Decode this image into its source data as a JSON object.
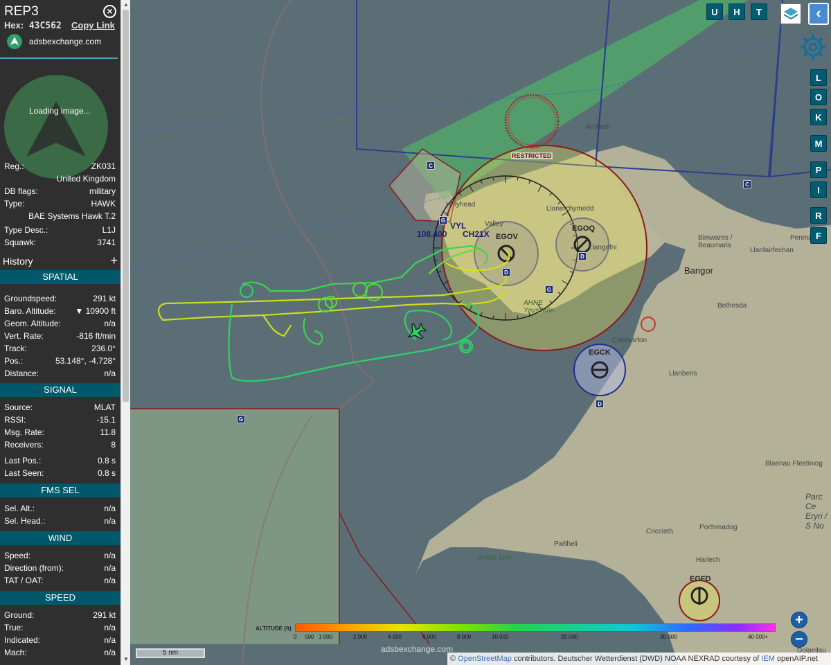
{
  "aircraft": {
    "callsign": "REP3",
    "hex_label": "Hex:",
    "hex": "43C562",
    "copy_link": "Copy Link",
    "brand": "adsbexchange.com",
    "photo_status": "Loading image..."
  },
  "details": [
    {
      "label": "Reg.:",
      "value": "ZK031"
    },
    {
      "label": "",
      "value": "United Kingdom"
    },
    {
      "label": "DB flags:",
      "value": "military"
    },
    {
      "label": "Type:",
      "value": "HAWK"
    },
    {
      "label": "",
      "value": "BAE Systems Hawk T.2"
    },
    {
      "label": "Type Desc.:",
      "value": "L1J"
    },
    {
      "label": "Squawk:",
      "value": "3741"
    }
  ],
  "history": {
    "label": "History",
    "toggle": "+"
  },
  "sections": {
    "spatial": {
      "title": "SPATIAL",
      "rows": [
        {
          "label": "Groundspeed:",
          "value": "291 kt"
        },
        {
          "label": "Baro. Altitude:",
          "value": "▼ 10900 ft"
        },
        {
          "label": "Geom. Altitude:",
          "value": "n/a"
        },
        {
          "label": "Vert. Rate:",
          "value": "-816 ft/min"
        },
        {
          "label": "Track:",
          "value": "236.0°"
        },
        {
          "label": "Pos.:",
          "value": "53.148°, -4.728°"
        },
        {
          "label": "Distance:",
          "value": "n/a"
        }
      ]
    },
    "signal": {
      "title": "SIGNAL",
      "rows": [
        {
          "label": "Source:",
          "value": "MLAT"
        },
        {
          "label": "RSSI:",
          "value": "-15.1"
        },
        {
          "label": "Msg. Rate:",
          "value": "11.8"
        },
        {
          "label": "Receivers:",
          "value": "8"
        },
        {
          "label": "Last Pos.:",
          "value": "0.8 s"
        },
        {
          "label": "Last Seen:",
          "value": "0.8 s"
        }
      ]
    },
    "fms": {
      "title": "FMS SEL",
      "rows": [
        {
          "label": "Sel. Alt.:",
          "value": "n/a"
        },
        {
          "label": "Sel. Head.:",
          "value": "n/a"
        }
      ]
    },
    "wind": {
      "title": "WIND",
      "rows": [
        {
          "label": "Speed:",
          "value": "n/a"
        },
        {
          "label": "Direction (from):",
          "value": "n/a"
        },
        {
          "label": "TAT / OAT:",
          "value": "n/a"
        }
      ]
    },
    "speed": {
      "title": "SPEED",
      "rows": [
        {
          "label": "Ground:",
          "value": "291 kt"
        },
        {
          "label": "True:",
          "value": "n/a"
        },
        {
          "label": "Indicated:",
          "value": "n/a"
        },
        {
          "label": "Mach:",
          "value": "n/a"
        }
      ]
    }
  },
  "toolbar": {
    "top_buttons": [
      "U",
      "H",
      "T"
    ],
    "side_buttons": [
      "L",
      "O",
      "K",
      "M",
      "P",
      "I",
      "R",
      "F"
    ],
    "zoom_in": "+",
    "zoom_out": "−",
    "back": "‹"
  },
  "map": {
    "places": {
      "amlwch": "Amlwch",
      "llanerchymedd": "Llanerchymedd",
      "holyhead": "Holyhead",
      "valley": "Valley",
      "llangefni": "Llangefni",
      "bangor": "Bangor",
      "beaumaris": "Bimwares / Beaumaris",
      "penmaenmawr": "Penmaenm",
      "llanfairfechan": "Llanfairfechan",
      "bethesda": "Bethesda",
      "caernarfon": "Caernarfon",
      "llanberis": "Llanberis",
      "ahne_ynys": "AHNE Ynys Môn",
      "blaenau": "Blaenau Ffestiniog",
      "parc": "Parc Ce Eryri / S No",
      "criccieth": "Criccieth",
      "porthmadog": "Porthmadog",
      "pwllheli": "Pwllheli",
      "harlech": "Harlech",
      "ahne_llyn": "AHNE Llŷn",
      "dolgellau": "Dolgellau"
    },
    "airports": {
      "egov": "EGOV",
      "egoq": "EGOQ",
      "egck": "EGCK",
      "egfd": "EGFD"
    },
    "vor": {
      "name": "VYL",
      "freq": "108.400",
      "channel": "CH21X"
    },
    "restricted": "RESTRICTED",
    "badges": {
      "c": "C",
      "d": "D",
      "g": "G"
    },
    "scale": "5 nm",
    "watermark": "adsbexchange.com"
  },
  "altitude_legend": {
    "title": "ALTITUDE (ft)",
    "ticks": [
      "0",
      "500",
      "1 000",
      "2 000",
      "4 000",
      "6 000",
      "8 000",
      "10 000",
      "20 000",
      "30 000",
      "40 000+"
    ]
  },
  "attribution": {
    "osm": "OpenStreetMap",
    "text1": "contributors. Deutscher Wetterdienst (DWD) NOAA NEXRAD courtesy of",
    "iem": "IEM",
    "text2": "openAIP.net"
  },
  "colors": {
    "sidebar_bg": "#2f2f2f",
    "section_header": "#00596b",
    "button": "#005c70",
    "sea": "#5b6e76",
    "land": "#b8b49a",
    "track_green": "#2fd264",
    "track_yellow": "#c9e01a"
  }
}
